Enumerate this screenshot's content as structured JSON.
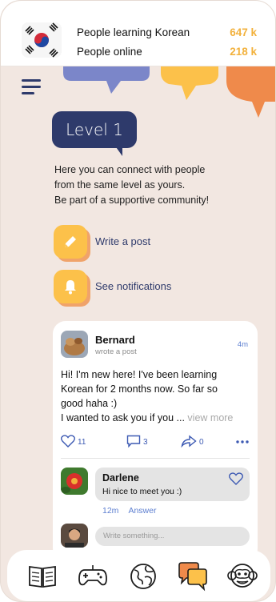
{
  "stats": {
    "learning_label": "People learning Korean",
    "learning_value": "647 k",
    "online_label": "People online",
    "online_value": "218 k"
  },
  "level": {
    "title": "Level 1"
  },
  "intro": {
    "line1": "Here you can connect with people",
    "line2": "from the same level as yours.",
    "line3": "Be part of a supportive community!"
  },
  "actions": {
    "write_post": "Write a post",
    "notifications": "See notifications"
  },
  "post": {
    "author": "Bernard",
    "subtitle": "wrote a post",
    "time": "4m",
    "body_line1": "Hi! I'm new here! I've been learning",
    "body_line2": "Korean for 2 months now. So far so",
    "body_line3": "good haha :)",
    "body_line4": "I wanted to ask you if you ... ",
    "view_more": "view more",
    "likes": "11",
    "comments": "3",
    "shares": "0"
  },
  "comment": {
    "author": "Darlene",
    "text": "Hi nice to meet you :)",
    "time": "12m",
    "answer": "Answer"
  },
  "reply": {
    "placeholder": "Write something..."
  },
  "colors": {
    "background": "#f2e7e1",
    "navy": "#2e3a6b",
    "yellow": "#fcc14a",
    "orange": "#ef8a4b",
    "periwinkle": "#7b86c9",
    "link": "#5d7fd0"
  },
  "nav": {
    "icons": [
      "book-icon",
      "gamepad-icon",
      "globe-icon",
      "chat-icon",
      "monkey-icon"
    ]
  }
}
